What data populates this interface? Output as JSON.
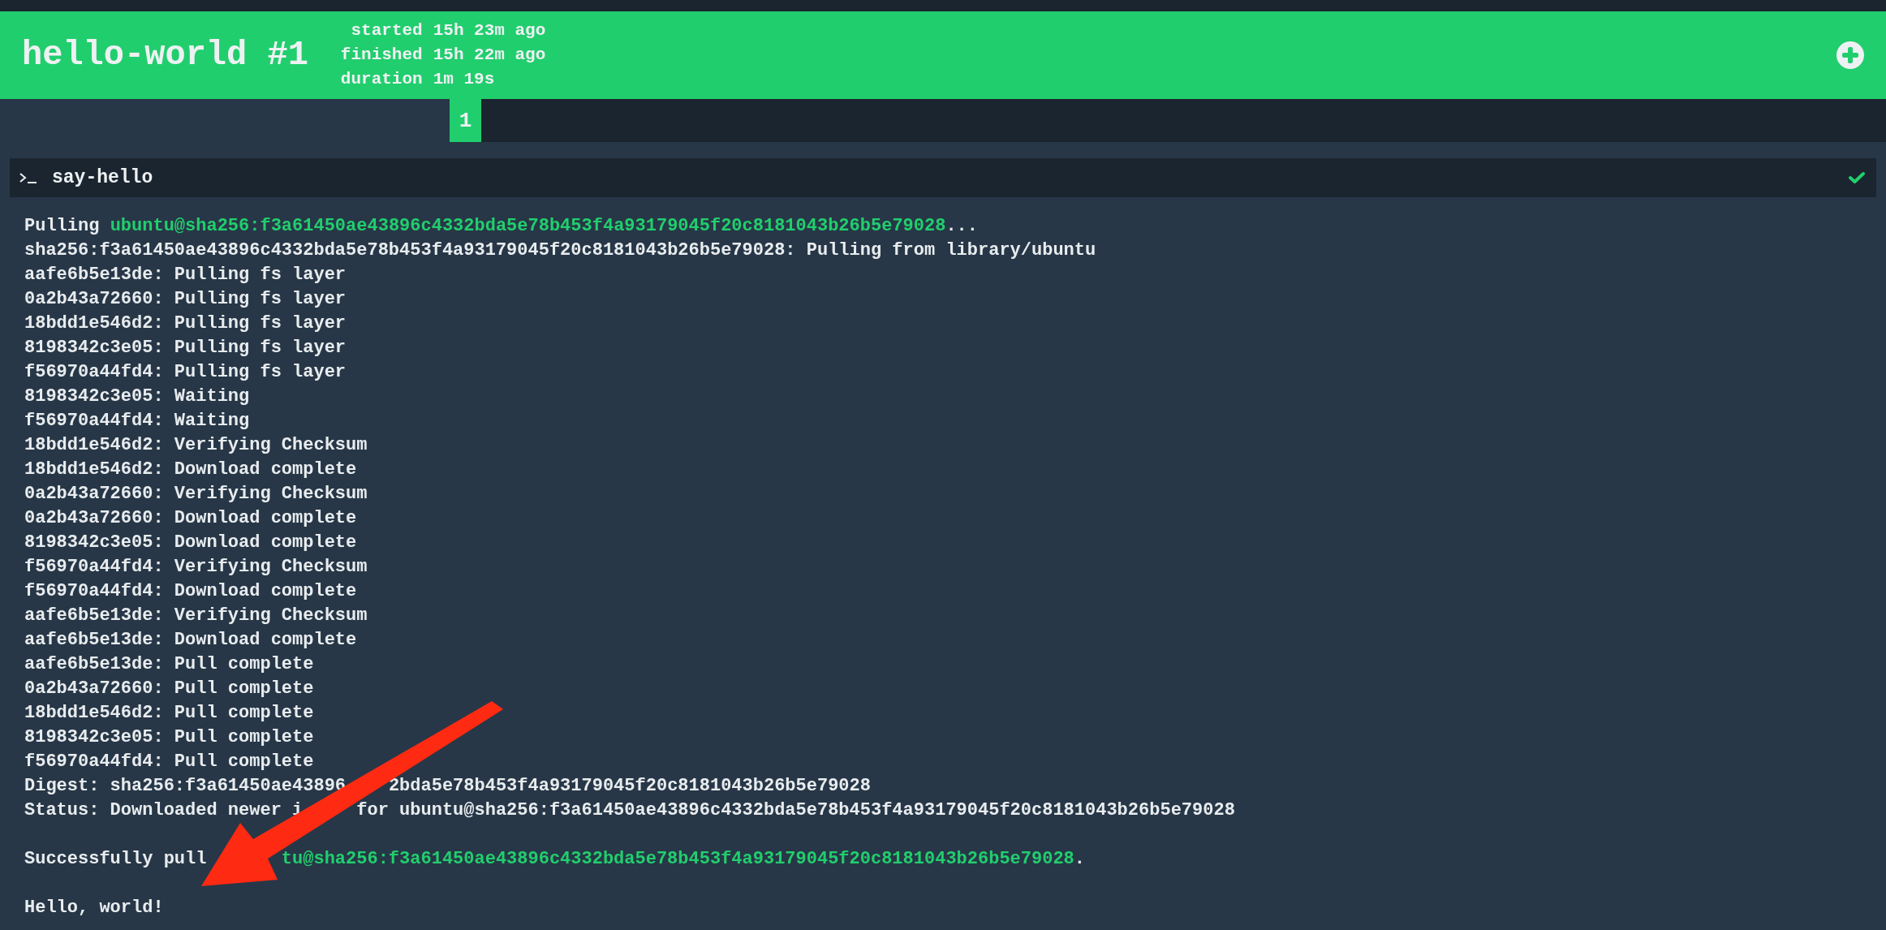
{
  "build": {
    "title": "hello-world #1",
    "meta": [
      {
        "label": "started",
        "value": "15h 23m ago"
      },
      {
        "label": "finished",
        "value": "15h 22m ago"
      },
      {
        "label": "duration",
        "value": "1m 19s"
      }
    ]
  },
  "tabs": [
    {
      "label": "1",
      "selected": true
    }
  ],
  "step": {
    "name": "say-hello",
    "passed": true,
    "log": [
      {
        "kind": "text",
        "segments": [
          {
            "text": "Pulling ",
            "kind": "plain"
          },
          {
            "text": "ubuntu@sha256:f3a61450ae43896c4332bda5e78b453f4a93179045f20c8181043b26b5e79028",
            "kind": "highlight"
          },
          {
            "text": "...",
            "kind": "plain"
          }
        ]
      },
      {
        "kind": "text",
        "segments": [
          {
            "text": "sha256:f3a61450ae43896c4332bda5e78b453f4a93179045f20c8181043b26b5e79028: Pulling from library/ubuntu",
            "kind": "plain"
          }
        ]
      },
      {
        "kind": "text",
        "segments": [
          {
            "text": "aafe6b5e13de: Pulling fs layer",
            "kind": "plain"
          }
        ]
      },
      {
        "kind": "text",
        "segments": [
          {
            "text": "0a2b43a72660: Pulling fs layer",
            "kind": "plain"
          }
        ]
      },
      {
        "kind": "text",
        "segments": [
          {
            "text": "18bdd1e546d2: Pulling fs layer",
            "kind": "plain"
          }
        ]
      },
      {
        "kind": "text",
        "segments": [
          {
            "text": "8198342c3e05: Pulling fs layer",
            "kind": "plain"
          }
        ]
      },
      {
        "kind": "text",
        "segments": [
          {
            "text": "f56970a44fd4: Pulling fs layer",
            "kind": "plain"
          }
        ]
      },
      {
        "kind": "text",
        "segments": [
          {
            "text": "8198342c3e05: Waiting",
            "kind": "plain"
          }
        ]
      },
      {
        "kind": "text",
        "segments": [
          {
            "text": "f56970a44fd4: Waiting",
            "kind": "plain"
          }
        ]
      },
      {
        "kind": "text",
        "segments": [
          {
            "text": "18bdd1e546d2: Verifying Checksum",
            "kind": "plain"
          }
        ]
      },
      {
        "kind": "text",
        "segments": [
          {
            "text": "18bdd1e546d2: Download complete",
            "kind": "plain"
          }
        ]
      },
      {
        "kind": "text",
        "segments": [
          {
            "text": "0a2b43a72660: Verifying Checksum",
            "kind": "plain"
          }
        ]
      },
      {
        "kind": "text",
        "segments": [
          {
            "text": "0a2b43a72660: Download complete",
            "kind": "plain"
          }
        ]
      },
      {
        "kind": "text",
        "segments": [
          {
            "text": "8198342c3e05: Download complete",
            "kind": "plain"
          }
        ]
      },
      {
        "kind": "text",
        "segments": [
          {
            "text": "f56970a44fd4: Verifying Checksum",
            "kind": "plain"
          }
        ]
      },
      {
        "kind": "text",
        "segments": [
          {
            "text": "f56970a44fd4: Download complete",
            "kind": "plain"
          }
        ]
      },
      {
        "kind": "text",
        "segments": [
          {
            "text": "aafe6b5e13de: Verifying Checksum",
            "kind": "plain"
          }
        ]
      },
      {
        "kind": "text",
        "segments": [
          {
            "text": "aafe6b5e13de: Download complete",
            "kind": "plain"
          }
        ]
      },
      {
        "kind": "text",
        "segments": [
          {
            "text": "aafe6b5e13de: Pull complete",
            "kind": "plain"
          }
        ]
      },
      {
        "kind": "text",
        "segments": [
          {
            "text": "0a2b43a72660: Pull complete",
            "kind": "plain"
          }
        ]
      },
      {
        "kind": "text",
        "segments": [
          {
            "text": "18bdd1e546d2: Pull complete",
            "kind": "plain"
          }
        ]
      },
      {
        "kind": "text",
        "segments": [
          {
            "text": "8198342c3e05: Pull complete",
            "kind": "plain"
          }
        ]
      },
      {
        "kind": "text",
        "segments": [
          {
            "text": "f56970a44fd4: Pull complete",
            "kind": "plain"
          }
        ]
      },
      {
        "kind": "text",
        "segments": [
          {
            "text": "Digest: sha256:f3a61450ae43896",
            "kind": "plain"
          },
          {
            "kind": "covered"
          },
          {
            "text": "2bda5e78b453f4a93179045f20c8181043b26b5e79028",
            "kind": "plain"
          }
        ]
      },
      {
        "kind": "text",
        "segments": [
          {
            "text": "Status: Downloaded newer i",
            "kind": "plain"
          },
          {
            "kind": "covered"
          },
          {
            "text": "for ubuntu@sha256:f3a61450ae43896c4332bda5e78b453f4a93179045f20c8181043b26b5e79028",
            "kind": "plain"
          }
        ]
      },
      {
        "kind": "blank"
      },
      {
        "kind": "text",
        "segments": [
          {
            "text": "Successfully pull",
            "kind": "plain"
          },
          {
            "kind": "covered"
          },
          {
            "text": "tu@sha256:f3a61450ae43896c4332bda5e78b453f4a93179045f20c8181043b26b5e79028",
            "kind": "highlight"
          },
          {
            "text": ".",
            "kind": "plain"
          }
        ]
      },
      {
        "kind": "blank"
      },
      {
        "kind": "text",
        "segments": [
          {
            "text": "Hello, world!",
            "kind": "plain"
          }
        ]
      }
    ]
  },
  "annotation": {
    "kind": "arrow"
  }
}
